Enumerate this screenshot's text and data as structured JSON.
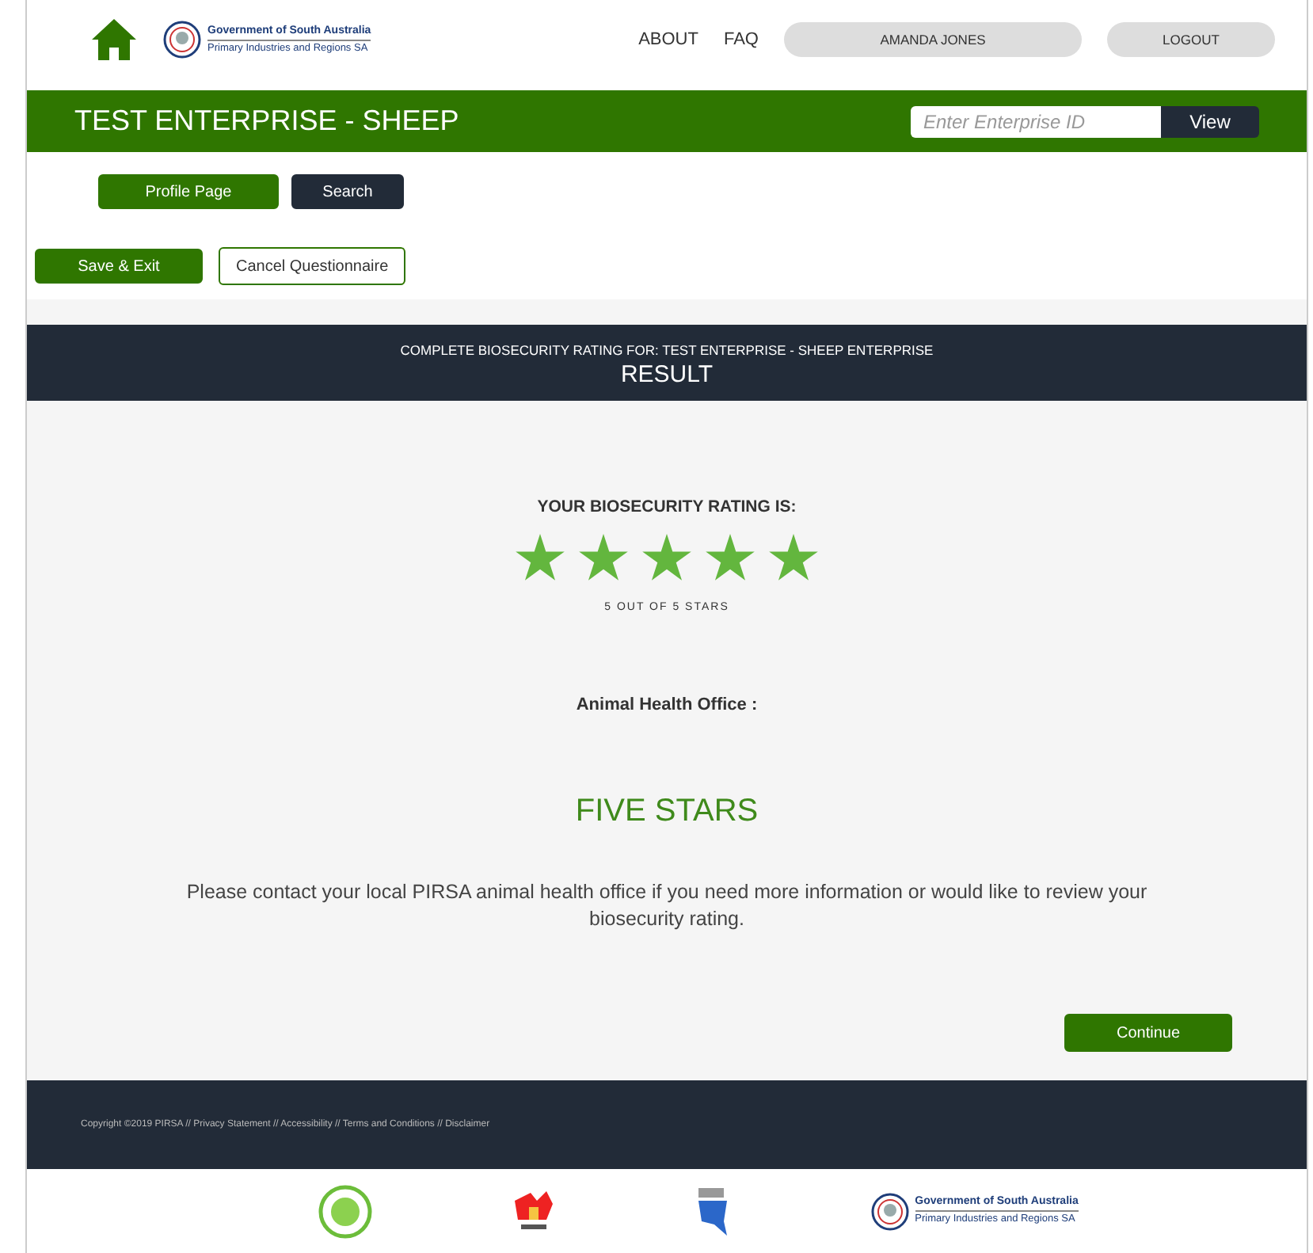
{
  "header": {
    "logo": {
      "line_1": "Government of South Australia",
      "line_2": "Primary Industries and Regions SA"
    },
    "nav": [
      "ABOUT",
      "FAQ"
    ],
    "user": "AMANDA JONES",
    "logout": "LOGOUT"
  },
  "enterprise_bar": {
    "title": "TEST ENTERPRISE - SHEEP",
    "search": {
      "placeholder": "Enter Enterprise ID"
    },
    "view_button": "View"
  },
  "tabs": [
    {
      "label": "Profile Page",
      "selected": true
    },
    {
      "label": "Search",
      "selected": false
    }
  ],
  "actions": [
    {
      "label": "Save & Exit",
      "kind": "primary"
    },
    {
      "label": "Cancel Questionnaire",
      "kind": "outline"
    }
  ],
  "banner": {
    "subtitle": "COMPLETE BIOSECURITY RATING FOR: TEST ENTERPRISE - SHEEP ENTERPRISE",
    "title": "RESULT"
  },
  "result": {
    "heading": "YOUR BIOSECURITY RATING IS:",
    "stars": 5,
    "stars_caption": "5 OUT OF 5 STARS",
    "office_label": "Animal Health Office :",
    "rating_text": "FIVE STARS",
    "message": "Please contact your local PIRSA animal health office if you need more information or would like to review your biosecurity rating.",
    "continue": "Continue"
  },
  "footer": {
    "copyright": "Copyright ©2019 PIRSA // Privacy Statement // Accessibility // Terms and Conditions // Disclaimer",
    "logo": {
      "line_1": "Government of South Australia",
      "line_2": "Primary Industries and Regions SA"
    }
  }
}
